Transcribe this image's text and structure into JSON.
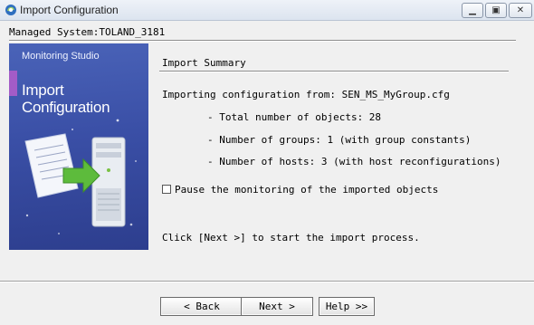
{
  "window": {
    "title": "Import Configuration",
    "controls": {
      "minimize_icon": "minimize-icon",
      "maximize_icon": "maximize-icon",
      "close_icon": "close-icon"
    }
  },
  "header": {
    "managed_system_line": "Managed System:TOLAND_3181"
  },
  "banner": {
    "product": "Monitoring Studio",
    "heading_line1": "Import",
    "heading_line2": "Configuration"
  },
  "summary": {
    "title": "Import Summary",
    "importing_line": "Importing configuration from: SEN_MS_MyGroup.cfg",
    "total_objects_line": "- Total number of objects: 28",
    "groups_line": "- Number of groups: 1 (with group constants)",
    "hosts_line": "- Number of hosts: 3 (with host reconfigurations)",
    "pause_checkbox_label": "Pause the monitoring of the imported objects",
    "pause_checked": false,
    "instruction": "Click [Next >] to start the import process."
  },
  "buttons": {
    "back": "< Back",
    "next": "Next >",
    "help": "Help >>"
  }
}
